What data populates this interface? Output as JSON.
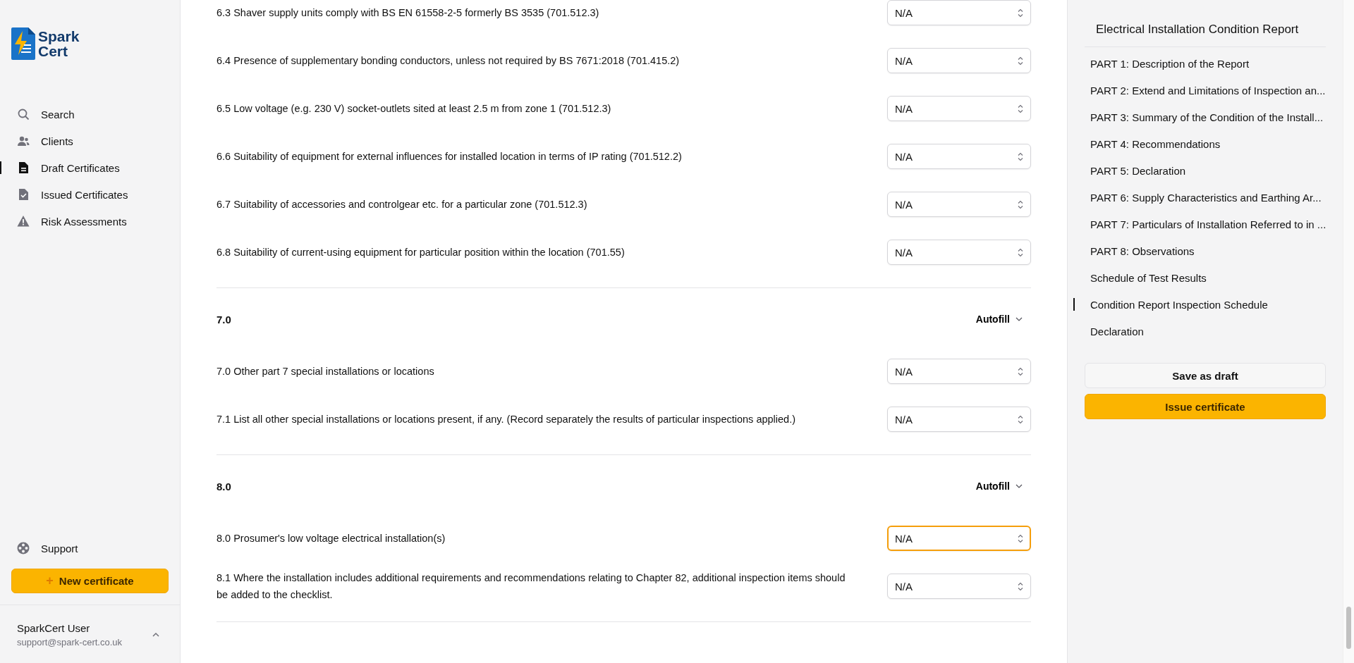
{
  "brand": {
    "line_1": "Spark",
    "line_2": "Cert"
  },
  "nav": [
    {
      "label": "Search",
      "selected": false
    },
    {
      "label": "Clients",
      "selected": false
    },
    {
      "label": "Draft Certificates",
      "selected": true
    },
    {
      "label": "Issued Certificates",
      "selected": false
    },
    {
      "label": "Risk Assessments",
      "selected": false
    }
  ],
  "support": {
    "label": "Support"
  },
  "new_certificate": {
    "icon": "+",
    "label": "New certificate"
  },
  "user": {
    "name": "SparkCert User",
    "email": "support@spark-cert.co.uk"
  },
  "sections": [
    {
      "items": [
        {
          "text": "6.3 Shaver supply units comply with BS EN 61558-2-5 formerly BS 3535 (701.512.3)",
          "value": "N/A",
          "focused": false
        },
        {
          "text": "6.4 Presence of supplementary bonding conductors, unless not required by BS 7671:2018 (701.415.2)",
          "value": "N/A",
          "focused": false
        },
        {
          "text": "6.5 Low voltage (e.g. 230 V) socket-outlets sited at least 2.5 m from zone 1 (701.512.3)",
          "value": "N/A",
          "focused": false
        },
        {
          "text": "6.6 Suitability of equipment for external influences for installed location in terms of IP rating (701.512.2)",
          "value": "N/A",
          "focused": false
        },
        {
          "text": "6.7 Suitability of accessories and controlgear etc. for a particular zone (701.512.3)",
          "value": "N/A",
          "focused": false
        },
        {
          "text": "6.8 Suitability of current-using equipment for particular position within the location (701.55)",
          "value": "N/A",
          "focused": false
        }
      ]
    },
    {
      "heading": "7.0",
      "autofill": "Autofill",
      "items": [
        {
          "text": "7.0 Other part 7 special installations or locations",
          "value": "N/A",
          "focused": false
        },
        {
          "text": "7.1 List all other special installations or locations present, if any. (Record separately the results of particular inspections applied.)",
          "value": "N/A",
          "focused": false
        }
      ]
    },
    {
      "heading": "8.0",
      "autofill": "Autofill",
      "items": [
        {
          "text": "8.0 Prosumer's low voltage electrical installation(s)",
          "value": "N/A",
          "focused": true
        },
        {
          "text": "8.1 Where the installation includes additional requirements and recommendations relating to Chapter 82, additional inspection items should be added to the checklist.",
          "value": "N/A",
          "focused": false
        }
      ]
    }
  ],
  "outline": {
    "title": "Electrical Installation Condition Report",
    "items": [
      {
        "label": "PART 1: Description of the Report",
        "selected": false
      },
      {
        "label": "PART 2: Extend and Limitations of Inspection an...",
        "selected": false
      },
      {
        "label": "PART 3: Summary of the Condition of the Install...",
        "selected": false
      },
      {
        "label": "PART 4: Recommendations",
        "selected": false
      },
      {
        "label": "PART 5: Declaration",
        "selected": false
      },
      {
        "label": "PART 6: Supply Characteristics and Earthing Ar...",
        "selected": false
      },
      {
        "label": "PART 7: Particulars of Installation Referred to in ...",
        "selected": false
      },
      {
        "label": "PART 8: Observations",
        "selected": false
      },
      {
        "label": "Schedule of Test Results",
        "selected": false
      },
      {
        "label": "Condition Report Inspection Schedule",
        "selected": true
      },
      {
        "label": "Declaration",
        "selected": false
      }
    ]
  },
  "actions": {
    "save": "Save as draft",
    "issue": "Issue certificate"
  }
}
